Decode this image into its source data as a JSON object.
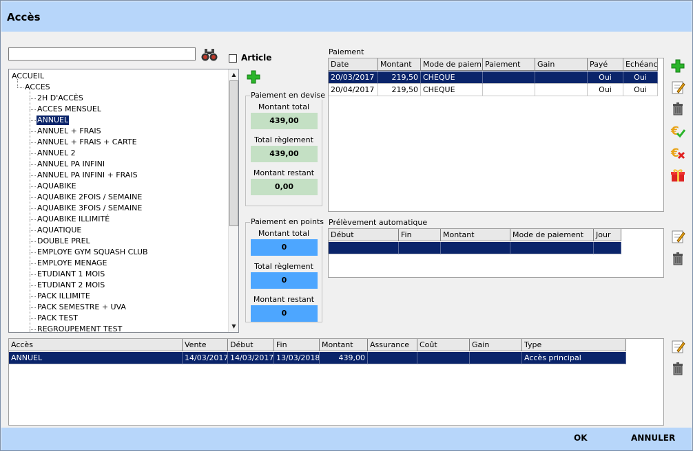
{
  "window": {
    "title": "Accès"
  },
  "search": {
    "value": ""
  },
  "article_checkbox": {
    "label": "Article",
    "checked": false
  },
  "tree": {
    "root": "ACCUEIL",
    "group": "ACCES",
    "items": [
      "2H D'ACCÈS",
      "ACCES MENSUEL",
      "ANNUEL",
      "ANNUEL + FRAIS",
      "ANNUEL + FRAIS + CARTE",
      "ANNUEL 2",
      "ANNUEL PA INFINI",
      "ANNUEL PA INFINI + FRAIS",
      "AQUABIKE",
      "AQUABIKE 2FOIS / SEMAINE",
      "AQUABIKE 3FOIS / SEMAINE",
      "AQUABIKE ILLIMITÉ",
      "AQUATIQUE",
      "DOUBLE PREL",
      "EMPLOYE GYM SQUASH CLUB",
      "EMPLOYE MENAGE",
      "ETUDIANT 1 MOIS",
      "ETUDIANT 2 MOIS",
      "PACK ILLIMITE",
      "PACK SEMESTRE + UVA",
      "PACK TEST",
      "REGROUPEMENT TEST"
    ],
    "selected": "ANNUEL"
  },
  "devise": {
    "title": "Paiement en devise",
    "total_label": "Montant total",
    "total": "439,00",
    "reglement_label": "Total règlement",
    "reglement": "439,00",
    "restant_label": "Montant restant",
    "restant": "0,00"
  },
  "points": {
    "title": "Paiement en points",
    "total_label": "Montant total",
    "total": "0",
    "reglement_label": "Total règlement",
    "reglement": "0",
    "restant_label": "Montant restant",
    "restant": "0"
  },
  "paiement": {
    "title": "Paiement",
    "headers": [
      "Date",
      "Montant",
      "Mode de paiem",
      "Paiement",
      "Gain",
      "Payé",
      "Echéance"
    ],
    "rows": [
      [
        "20/03/2017",
        "219,50",
        "CHEQUE",
        "",
        "",
        "Oui",
        "Oui"
      ],
      [
        "20/04/2017",
        "219,50",
        "CHEQUE",
        "",
        "",
        "Oui",
        "Oui"
      ]
    ]
  },
  "prelevement": {
    "title": "Prélèvement automatique",
    "headers": [
      "Début",
      "Fin",
      "Montant",
      "Mode de paiement",
      "Jour"
    ]
  },
  "acces": {
    "headers": [
      "Accès",
      "Vente",
      "Début",
      "Fin",
      "Montant",
      "Assurance",
      "Coût",
      "Gain",
      "Type"
    ],
    "rows": [
      [
        "ANNUEL",
        "14/03/2017",
        "14/03/2017",
        "13/03/2018",
        "439,00",
        "",
        "",
        "",
        "Accès principal"
      ]
    ]
  },
  "footer": {
    "ok": "OK",
    "cancel": "ANNULER"
  },
  "colors": {
    "titlebar": "#b7d6fa",
    "selection": "#0a246a",
    "green_box": "#c4e0c4",
    "blue_box": "#4da6ff"
  }
}
